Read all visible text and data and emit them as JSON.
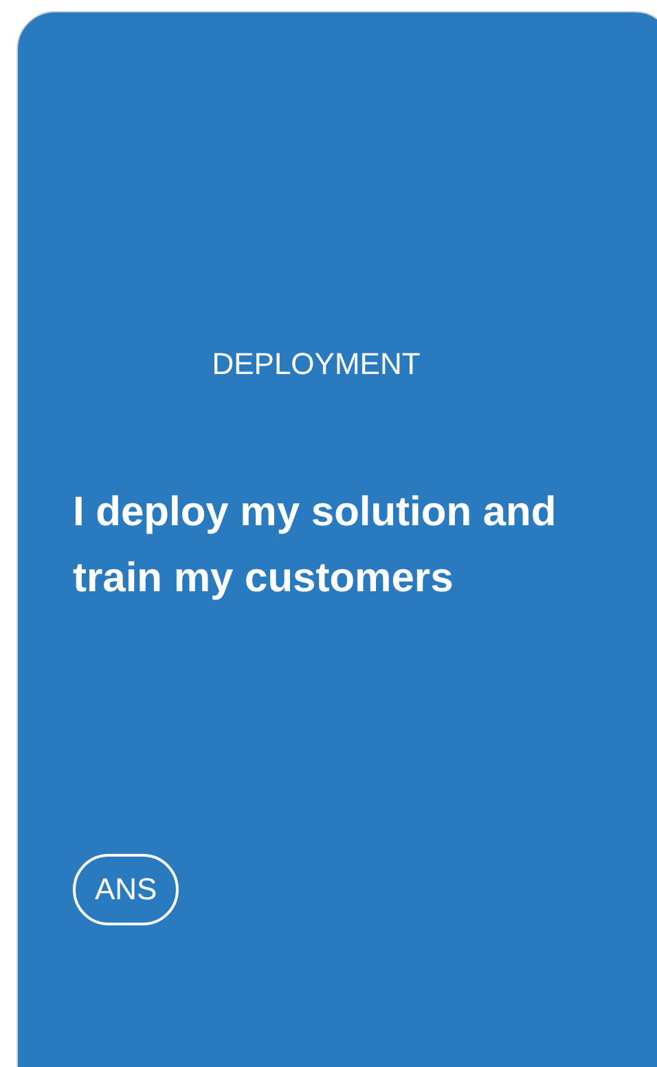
{
  "card": {
    "category": "DEPLOYMENT",
    "statement": "I deploy my solution and train my customers",
    "button": "ANS"
  }
}
